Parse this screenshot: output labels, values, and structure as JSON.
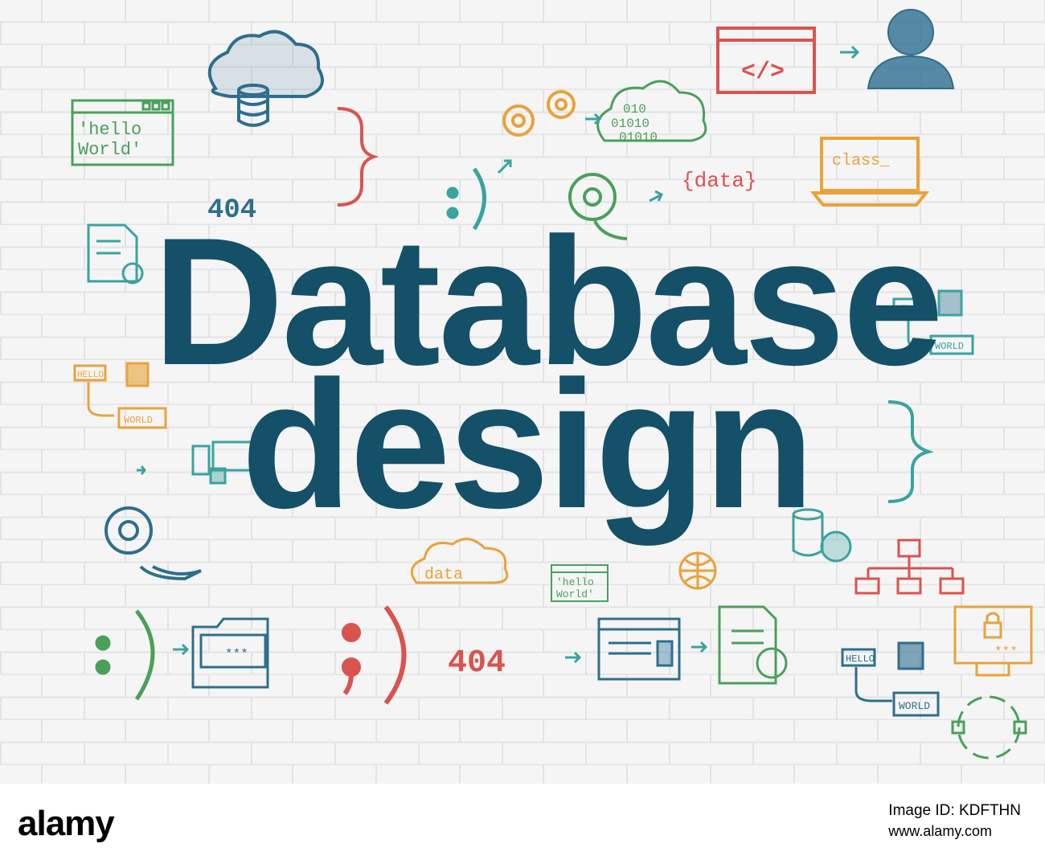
{
  "headline": {
    "line1": "Database",
    "line2": "design"
  },
  "sketch_labels": {
    "hello_world": "'hello\nWorld'",
    "hello_world_small": "'hello\nWorld'",
    "code_404_top": "404",
    "code_404_bottom": "404",
    "data_braces": "{data}",
    "data_cloud": "data",
    "class_laptop": "class_",
    "binary_row1": "010",
    "binary_row2": "01010",
    "binary_row3": "01010",
    "code_tag": "</>",
    "hello_small": "HELLO",
    "world_small": "WORLD",
    "password_mask": "***"
  },
  "icons": [
    "cloud-database-icon",
    "browser-window-icon",
    "brace-icon",
    "arrow-icon",
    "gear-icon",
    "binary-cloud-icon",
    "code-window-icon",
    "programmer-icon",
    "data-brace-icon",
    "laptop-icon",
    "smiley-icon",
    "map-pin-icon",
    "document-gear-icon",
    "network-diagram-icon",
    "mobile-browser-icon",
    "database-lock-icon",
    "hierarchy-icon",
    "globe-icon",
    "folder-icon",
    "webpage-icon",
    "lock-screen-icon",
    "cycle-icon"
  ],
  "colors": {
    "headline": "#145068",
    "sketch_red": "#d9534f",
    "sketch_green": "#4aa05a",
    "sketch_blue": "#2e6e8e",
    "sketch_orange": "#e8a33a",
    "sketch_teal": "#3aa3a0",
    "wall": "#f4f4f4",
    "mortar": "#e2e2e2"
  },
  "watermark": {
    "brand": "alamy",
    "image_id": "Image ID: KDFTHN",
    "site": "www.alamy.com"
  }
}
